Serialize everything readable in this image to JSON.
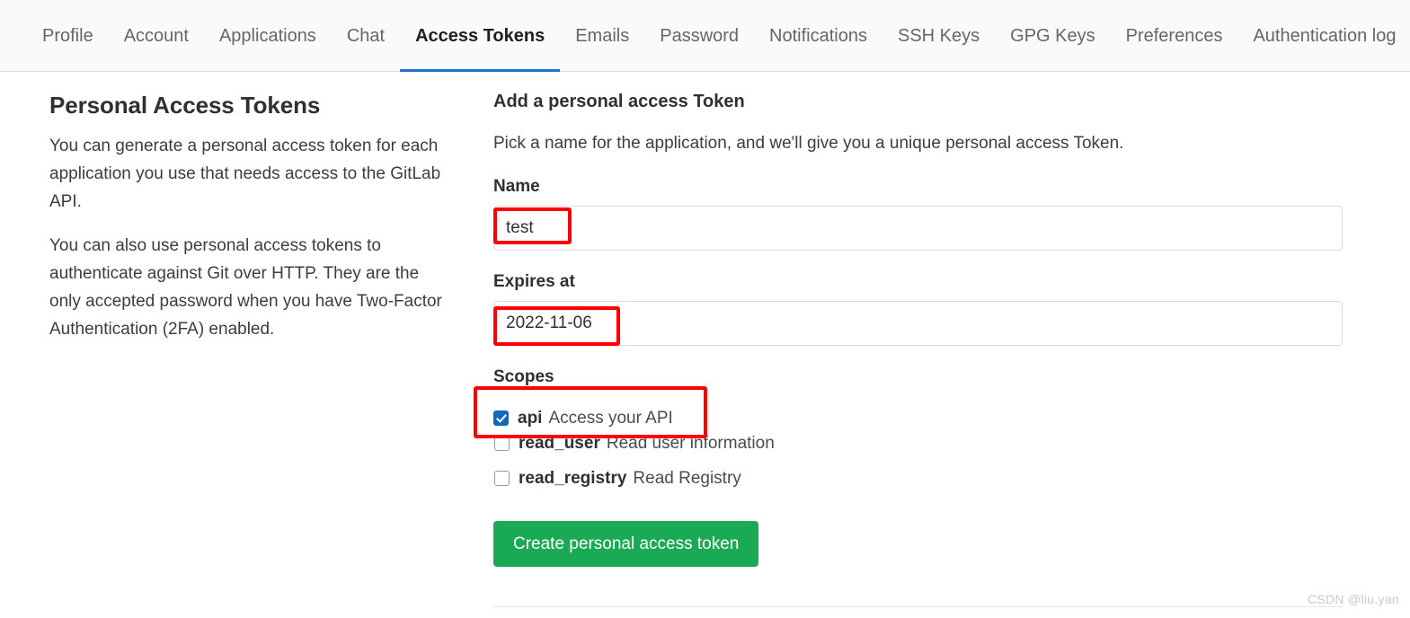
{
  "tabs": [
    {
      "label": "Profile",
      "active": false
    },
    {
      "label": "Account",
      "active": false
    },
    {
      "label": "Applications",
      "active": false
    },
    {
      "label": "Chat",
      "active": false
    },
    {
      "label": "Access Tokens",
      "active": true
    },
    {
      "label": "Emails",
      "active": false
    },
    {
      "label": "Password",
      "active": false
    },
    {
      "label": "Notifications",
      "active": false
    },
    {
      "label": "SSH Keys",
      "active": false
    },
    {
      "label": "GPG Keys",
      "active": false
    },
    {
      "label": "Preferences",
      "active": false
    },
    {
      "label": "Authentication log",
      "active": false
    }
  ],
  "sidebar": {
    "title": "Personal Access Tokens",
    "paragraphs": [
      "You can generate a personal access token for each application you use that needs access to the GitLab API.",
      "You can also use personal access tokens to authenticate against Git over HTTP. They are the only accepted password when you have Two-Factor Authentication (2FA) enabled."
    ]
  },
  "form": {
    "heading": "Add a personal access Token",
    "subheading": "Pick a name for the application, and we'll give you a unique personal access Token.",
    "name": {
      "label": "Name",
      "value": "test",
      "placeholder": ""
    },
    "expires_at": {
      "label": "Expires at",
      "value": "2022-11-06",
      "placeholder": ""
    },
    "scopes": {
      "label": "Scopes",
      "items": [
        {
          "code": "api",
          "desc": "Access your API",
          "checked": true
        },
        {
          "code": "read_user",
          "desc": "Read user information",
          "checked": false
        },
        {
          "code": "read_registry",
          "desc": "Read Registry",
          "checked": false
        }
      ]
    },
    "submit_label": "Create personal access token"
  },
  "annotations": {
    "color": "#ff0000",
    "boxes": [
      "name-value",
      "expires-value",
      "api-scope-row"
    ]
  },
  "watermark": "CSDN @liu.yan",
  "colors": {
    "accent_blue": "#1f75cb",
    "checkbox_blue": "#1068bf",
    "button_green": "#1aaa55",
    "annotation_red": "#ff0000",
    "tabbar_bg": "#fafafa",
    "text_dark": "#303030"
  }
}
